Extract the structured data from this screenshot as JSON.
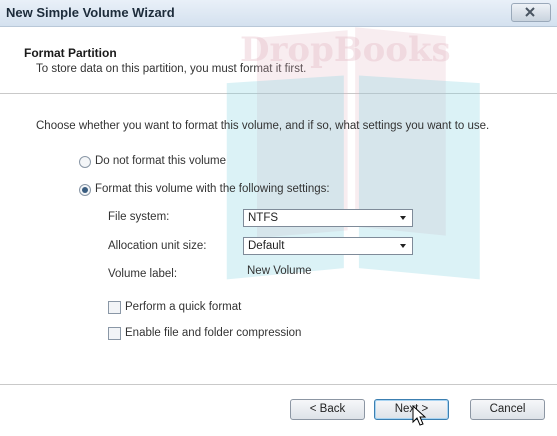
{
  "window": {
    "title": "New Simple Volume Wizard"
  },
  "header": {
    "title": "Format Partition",
    "subtitle": "To store data on this partition, you must format it first."
  },
  "content": {
    "intro": "Choose whether you want to format this volume, and if so, what settings you want to use.",
    "options": {
      "no_format": {
        "label": "Do not format this volume",
        "selected": false
      },
      "format": {
        "label": "Format this volume with the following settings:",
        "selected": true
      }
    },
    "settings": {
      "file_system": {
        "label": "File system:",
        "value": "NTFS"
      },
      "allocation": {
        "label": "Allocation unit size:",
        "value": "Default"
      },
      "volume_label": {
        "label": "Volume label:",
        "value": "New Volume"
      }
    },
    "checkboxes": {
      "quick_format": {
        "label": "Perform a quick format",
        "checked": false
      },
      "compression": {
        "label": "Enable file and folder compression",
        "checked": false
      }
    }
  },
  "footer": {
    "back": "< Back",
    "next": "Next >",
    "cancel": "Cancel"
  },
  "watermark": {
    "text": "DropBooks"
  },
  "colors": {
    "accent": "#3a5d80",
    "watermark_pink": "#e3b6c2",
    "watermark_teal": "#7fd0de"
  }
}
